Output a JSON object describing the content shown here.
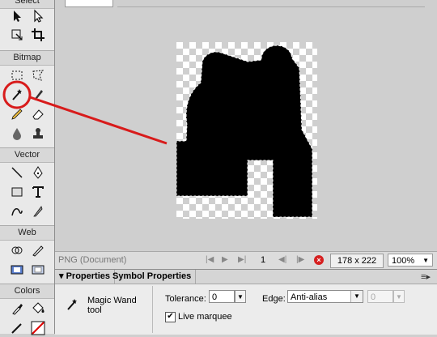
{
  "toolbar": {
    "top_section_label": "Select",
    "bitmap_label": "Bitmap",
    "vector_label": "Vector",
    "web_label": "Web",
    "colors_label": "Colors"
  },
  "statusbar": {
    "document_label": "PNG (Document)",
    "page_number": "1",
    "dimensions": "178 x 222",
    "zoom": "100%"
  },
  "properties_panel": {
    "tabs": [
      "Properties",
      "Symbol Properties"
    ],
    "tool_name": "Magic Wand tool",
    "tolerance_label": "Tolerance:",
    "tolerance_value": "0",
    "edge_label": "Edge:",
    "edge_value": "Anti-alias",
    "feather_value": "0",
    "live_marquee_label": "Live marquee",
    "live_marquee_checked": true
  },
  "annotation": {
    "color": "#d81b1b"
  },
  "colors": {
    "image_fill": "#000000",
    "checker_dark": "#cfcfcf",
    "checker_light": "#ffffff"
  }
}
